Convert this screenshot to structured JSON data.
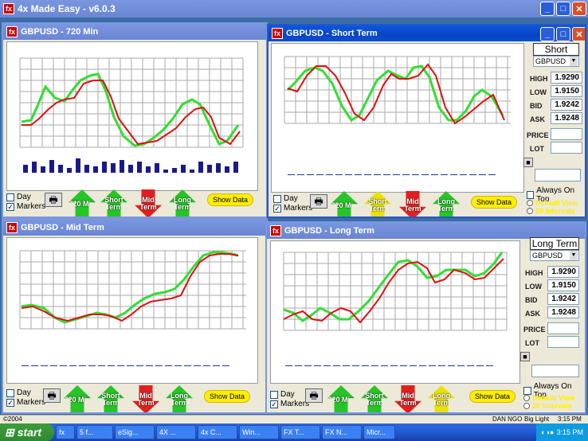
{
  "app": {
    "title": "4x Made Easy - v6.0.3",
    "icon": "fx"
  },
  "windows": {
    "w720": {
      "title": "GBPUSD - 720 Min"
    },
    "short": {
      "title": "GBPUSD - Short Term",
      "label": "Short",
      "pair": "GBPUSD",
      "high": "1.9290",
      "low": "1.9150",
      "bid": "1.9242",
      "ask": "1.9248",
      "always_on_top": "Always On Top",
      "default_view": "Default View",
      "intervals": "20 Intervals"
    },
    "mid": {
      "title": "GBPUSD - Mid Term"
    },
    "long": {
      "title": "GBPUSD - Long Term",
      "label": "Long Term",
      "pair": "GBPUSD",
      "high": "1.9290",
      "low": "1.9150",
      "bid": "1.9242",
      "ask": "1.9248",
      "always_on_top": "Always On Top",
      "default_view": "Default View",
      "intervals": "20 Intervals"
    }
  },
  "labels": {
    "high": "HIGH",
    "low": "LOW",
    "bid": "BID",
    "ask": "ASK",
    "price": "PRICE",
    "lot": "LOT",
    "day": "Day",
    "markers": "Markers",
    "show_data": "Show Data",
    "min720": "720 Min",
    "short": "Short Term",
    "mid": "Mid Term",
    "long": "Long Term"
  },
  "statusbar": {
    "copyright": "©2004",
    "user": "DAN NGO",
    "light": "Big Light",
    "time": "3:15 PM"
  },
  "taskbar": {
    "start": "start",
    "tasks": [
      "5 f...",
      "eSig...",
      "4X ...",
      "4x C...",
      "Win...",
      "FX T...",
      "FX N...",
      "Micr..."
    ],
    "clock": "3:15 PM"
  },
  "colors": {
    "green": "#33dd33",
    "red": "#dd1111",
    "bars": "#1a1a8a"
  }
}
